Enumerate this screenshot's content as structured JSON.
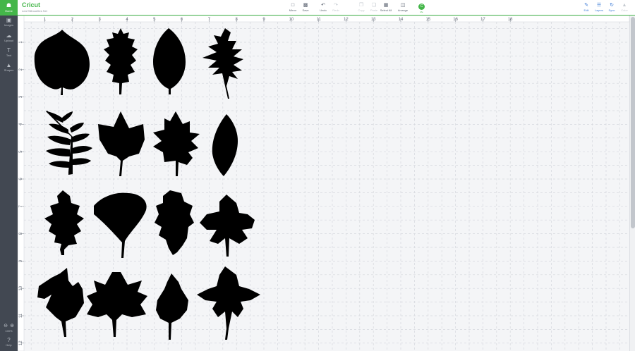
{
  "app": {
    "brand": "Cricut",
    "document_name": "Leaf Silhouettes Set",
    "accent_color": "#44b649",
    "link_color": "#3d7bd6"
  },
  "rail": {
    "home": {
      "label": "Home",
      "icon": "home-icon"
    },
    "items": [
      {
        "label": "Images",
        "icon": "images-icon"
      },
      {
        "label": "Upload",
        "icon": "upload-icon"
      },
      {
        "label": "Text",
        "icon": "text-icon"
      },
      {
        "label": "Shapes",
        "icon": "shapes-icon"
      }
    ],
    "zoom": "100%",
    "help": "Help"
  },
  "toolbar": {
    "left": [
      {
        "label": "Mirror",
        "icon": "folder-icon",
        "enabled": true
      },
      {
        "label": "Save",
        "icon": "save-icon",
        "enabled": true
      },
      {
        "label": "Undo",
        "icon": "undo-icon",
        "enabled": true
      },
      {
        "label": "Redo",
        "icon": "redo-icon",
        "enabled": false
      },
      {
        "label": "Copy",
        "icon": "copy-icon",
        "enabled": false
      },
      {
        "label": "Paste",
        "icon": "paste-icon",
        "enabled": false
      },
      {
        "label": "Select All",
        "icon": "select-all-icon",
        "enabled": true
      },
      {
        "label": "Arrange",
        "icon": "arrange-icon",
        "enabled": true
      }
    ],
    "avatar_initial": "C",
    "avatar_name": "Me",
    "right": [
      {
        "label": "Edit",
        "icon": "edit-icon",
        "enabled": true
      },
      {
        "label": "Layers",
        "icon": "layers-icon",
        "enabled": true
      },
      {
        "label": "Sync",
        "icon": "sync-icon",
        "enabled": true
      },
      {
        "label": "Color",
        "icon": "color-icon",
        "enabled": false
      }
    ]
  },
  "ruler": {
    "top_numbers": [
      "1",
      "2",
      "3",
      "4",
      "5",
      "6",
      "7",
      "8",
      "9",
      "10",
      "11",
      "12",
      "13",
      "14",
      "15",
      "16",
      "17",
      "18"
    ],
    "left_numbers": [
      "1",
      "2",
      "3",
      "4",
      "5",
      "6",
      "7",
      "8",
      "9",
      "10",
      "11",
      "12"
    ]
  },
  "canvas": {
    "background": "#f4f5f7",
    "leaf_color": "#000000",
    "leaves": [
      {
        "name": "heart-leaf",
        "row": 1,
        "col": 1
      },
      {
        "name": "oak-leaf",
        "row": 1,
        "col": 2
      },
      {
        "name": "elm-leaf",
        "row": 1,
        "col": 3
      },
      {
        "name": "pin-oak-leaf",
        "row": 1,
        "col": 4
      },
      {
        "name": "fern-leaf",
        "row": 2,
        "col": 1
      },
      {
        "name": "maple-leaf",
        "row": 2,
        "col": 2
      },
      {
        "name": "red-oak-leaf",
        "row": 2,
        "col": 3
      },
      {
        "name": "oval-leaf",
        "row": 2,
        "col": 4
      },
      {
        "name": "white-oak-leaf",
        "row": 3,
        "col": 1
      },
      {
        "name": "ginkgo-leaf",
        "row": 3,
        "col": 2
      },
      {
        "name": "lobed-oak-leaf",
        "row": 3,
        "col": 3
      },
      {
        "name": "chestnut-leaf",
        "row": 3,
        "col": 4
      },
      {
        "name": "sassafras-leaf",
        "row": 4,
        "col": 1
      },
      {
        "name": "sugar-maple-leaf",
        "row": 4,
        "col": 2
      },
      {
        "name": "birch-leaf",
        "row": 4,
        "col": 3
      },
      {
        "name": "palmate-leaf",
        "row": 4,
        "col": 4
      }
    ]
  }
}
